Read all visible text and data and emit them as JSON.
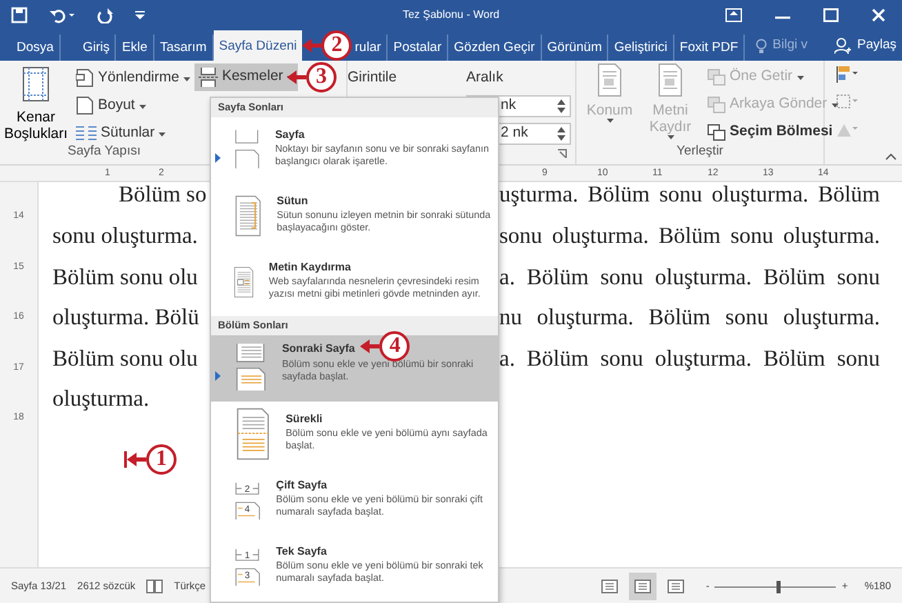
{
  "window": {
    "title": "Tez Şablonu - Word"
  },
  "ribbon_tabs": [
    {
      "label": "Dosya",
      "selected": false
    },
    {
      "label": "Giriş",
      "selected": false
    },
    {
      "label": "Ekle",
      "selected": false
    },
    {
      "label": "Tasarım",
      "selected": false
    },
    {
      "label": "Sayfa Düzeni",
      "selected": true,
      "callout": "2"
    },
    {
      "label": "rular",
      "selected": false
    },
    {
      "label": "Postalar",
      "selected": false
    },
    {
      "label": "Gözden Geçir",
      "selected": false
    },
    {
      "label": "Görünüm",
      "selected": false
    },
    {
      "label": "Geliştirici",
      "selected": false
    },
    {
      "label": "Foxit PDF",
      "selected": false
    }
  ],
  "tell_me": "Bilgi v",
  "share": "Paylaş",
  "page_setup": {
    "margins": "Kenar Boşlukları",
    "orientation": "Yönlendirme",
    "size": "Boyut",
    "columns": "Sütunlar",
    "breaks": {
      "label": "Kesmeler",
      "open": true,
      "callout": "3"
    },
    "group_label": "Sayfa Yapısı"
  },
  "paragraph": {
    "indent_label": "Girintile",
    "spacing_label": "Aralık",
    "spacing_before": "nk",
    "spacing_after": "2 nk"
  },
  "arrange": {
    "group_label": "Yerleştir",
    "buttons": [
      {
        "kind": "large",
        "label": "Konum",
        "disabled": true
      },
      {
        "kind": "large",
        "label": "Metni Kaydır",
        "disabled": true
      },
      {
        "kind": "small",
        "label": "Öne Getir",
        "disabled": true
      },
      {
        "kind": "small",
        "label": "Arkaya Gönder",
        "disabled": true
      },
      {
        "kind": "small",
        "label": "Seçim Bölmesi",
        "disabled": false
      }
    ]
  },
  "ruler": {
    "left_numbers": [
      "1",
      "2"
    ],
    "right_numbers": [
      "9",
      "10",
      "11",
      "12",
      "13",
      "14"
    ],
    "vertical_numbers": [
      "14",
      "15",
      "16",
      "17",
      "18"
    ]
  },
  "document": {
    "lines": [
      {
        "left": "Bölüm so",
        "right": "uşturma. Bölüm sonu oluşturma. Bölüm"
      },
      {
        "left": "sonu oluşturma.",
        "right": "sonu oluşturma. Bölüm sonu oluşturma."
      },
      {
        "left": "Bölüm sonu olu",
        "right": "a. Bölüm sonu oluşturma. Bölüm sonu"
      },
      {
        "left": "oluşturma. Bölü",
        "right": "nu oluşturma. Bölüm sonu oluşturma."
      },
      {
        "left": "Bölüm sonu olu",
        "right": "a. Bölüm sonu oluşturma. Bölüm sonu"
      },
      {
        "left": "oluşturma."
      }
    ],
    "cursor_callout": "1"
  },
  "breaks_menu": {
    "sections": [
      {
        "heading": "Sayfa Sonları",
        "items": [
          {
            "kind": "page",
            "title": "Sayfa",
            "description": "Noktayı bir sayfanın sonu ve bir sonraki sayfanın başlangıcı olarak işaretle.",
            "selected": false,
            "marker": true
          },
          {
            "kind": "column",
            "title": "Sütun",
            "description": "Sütun sonunu izleyen metnin bir sonraki sütunda başlayacağını göster.",
            "selected": false,
            "marker": false
          },
          {
            "kind": "wrap",
            "title": "Metin Kaydırma",
            "description": "Web sayfalarında nesnelerin çevresindeki resim yazısı metni gibi metinleri gövde metninden ayır.",
            "selected": false,
            "marker": false
          }
        ]
      },
      {
        "heading": "Bölüm Sonları",
        "items": [
          {
            "kind": "next",
            "title": "Sonraki Sayfa",
            "description": "Bölüm sonu ekle ve yeni bölümü bir sonraki sayfada başlat.",
            "selected": true,
            "marker": true,
            "callout": "4"
          },
          {
            "kind": "continuous",
            "title": "Sürekli",
            "description": "Bölüm sonu ekle ve yeni bölümü aynı sayfada başlat.",
            "selected": false,
            "marker": false
          },
          {
            "kind": "pages",
            "digits": [
              "2",
              "4"
            ],
            "title": "Çift Sayfa",
            "description": "Bölüm sonu ekle ve yeni bölümü bir sonraki çift numaralı sayfada başlat.",
            "selected": false,
            "marker": false
          },
          {
            "kind": "pages",
            "digits": [
              "1",
              "3"
            ],
            "title": "Tek Sayfa",
            "description": "Bölüm sonu ekle ve yeni bölümü bir sonraki tek numaralı sayfada başlat.",
            "selected": false,
            "marker": false
          }
        ]
      }
    ]
  },
  "status_bar": {
    "page": "Sayfa 13/21",
    "words": "2612 sözcük",
    "language": "Türkçe",
    "views": [
      {
        "selected": false
      },
      {
        "selected": true
      },
      {
        "selected": false
      }
    ],
    "zoom_out": "-",
    "zoom_in": "+",
    "zoom": {
      "level": 0.52
    },
    "zoom_text": "%180"
  }
}
